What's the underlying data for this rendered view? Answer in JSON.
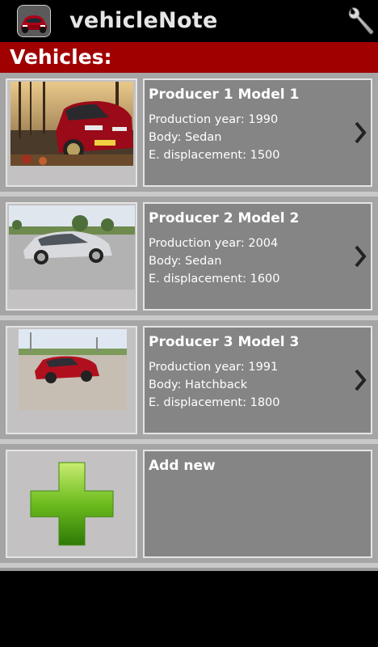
{
  "app": {
    "title": "vehicleNote",
    "icon": "car-app-icon",
    "settings_icon": "wrench-icon"
  },
  "header": {
    "title": "Vehicles:"
  },
  "vehicles": [
    {
      "name": "Producer 1 Model 1",
      "year_line": "Production year: 1990",
      "body_line": "Body: Sedan",
      "displacement_line": "E. displacement: 1500",
      "photo": "red-sedan-photo"
    },
    {
      "name": "Producer 2 Model 2",
      "year_line": "Production year: 2004",
      "body_line": "Body: Sedan",
      "displacement_line": "E. displacement: 1600",
      "photo": "silver-sedan-photo"
    },
    {
      "name": "Producer 3 Model 3",
      "year_line": "Production year: 1991",
      "body_line": "Body: Hatchback",
      "displacement_line": "E. displacement: 1800",
      "photo": "red-hatchback-photo"
    }
  ],
  "add_new": {
    "label": "Add new",
    "icon": "plus-icon"
  },
  "colors": {
    "header_bar": "#a00000",
    "list_bg": "#9b9b9b",
    "info_box": "#858585",
    "plus_green": "#5fb31a"
  }
}
